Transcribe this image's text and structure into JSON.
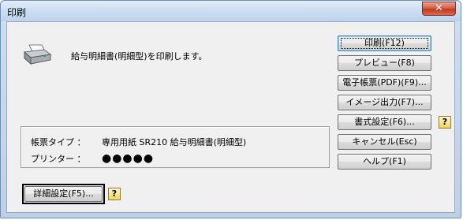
{
  "window": {
    "title": "印刷",
    "close_label": "✕"
  },
  "message": "給与明細書(明細型)を印刷します。",
  "info": {
    "form_type_label": "帳票タイプ ：",
    "form_type_value": "専用用紙 SR210 給与明細書(明細型)",
    "printer_label": "プリンター ：",
    "printer_value": "●●●●●"
  },
  "buttons": {
    "print": "印刷(F12)",
    "preview": "プレビュー(F8)",
    "e_form": "電子帳票(PDF)(F9)...",
    "image_output": "イメージ出力(F7)...",
    "format_settings": "書式設定(F6)...",
    "cancel": "キャンセル(Esc)",
    "help": "ヘルプ(F1)",
    "detail_settings": "詳細設定(F5)..."
  },
  "help_icon_glyph": "?",
  "icons": {
    "printer": "printer-icon",
    "help": "help-icon",
    "close": "close-icon"
  }
}
